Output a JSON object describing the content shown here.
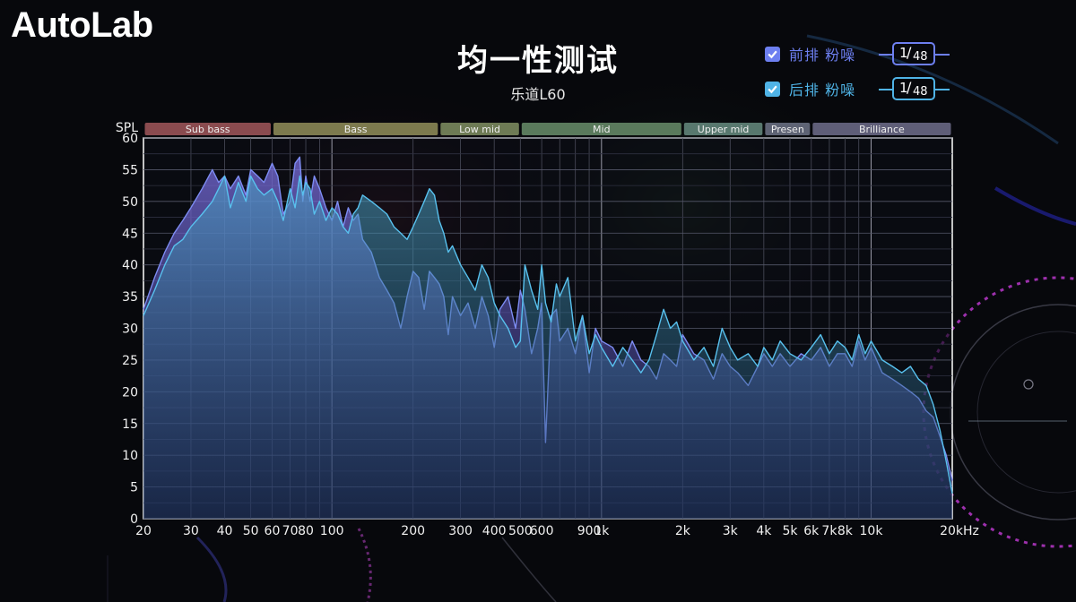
{
  "logo": "AutoLab",
  "title": "均一性测试",
  "subtitle": "乐道L60",
  "legend": [
    {
      "label": "前排 粉噪",
      "checked": true,
      "color": "#6d7ff0",
      "octave_num": "1",
      "octave_den": "48"
    },
    {
      "label": "后排 粉噪",
      "checked": true,
      "color": "#4fb3e6",
      "octave_num": "1",
      "octave_den": "48"
    }
  ],
  "chart_data": {
    "type": "area",
    "x_scale": "log",
    "xlim": [
      20,
      20000
    ],
    "ylim": [
      0,
      60
    ],
    "ylabel": "SPL",
    "y_ticks": [
      0,
      5,
      10,
      15,
      20,
      25,
      30,
      35,
      40,
      45,
      50,
      55,
      60
    ],
    "x_ticks": [
      {
        "v": 20,
        "label": "20"
      },
      {
        "v": 30,
        "label": "30"
      },
      {
        "v": 40,
        "label": "40"
      },
      {
        "v": 50,
        "label": "50"
      },
      {
        "v": 60,
        "label": "60"
      },
      {
        "v": 70,
        "label": "70"
      },
      {
        "v": 80,
        "label": "80"
      },
      {
        "v": 100,
        "label": "100"
      },
      {
        "v": 200,
        "label": "200"
      },
      {
        "v": 300,
        "label": "300"
      },
      {
        "v": 400,
        "label": "400"
      },
      {
        "v": 500,
        "label": "500"
      },
      {
        "v": 600,
        "label": "600"
      },
      {
        "v": 900,
        "label": "900"
      },
      {
        "v": 1000,
        "label": "1k"
      },
      {
        "v": 2000,
        "label": "2k"
      },
      {
        "v": 3000,
        "label": "3k"
      },
      {
        "v": 4000,
        "label": "4k"
      },
      {
        "v": 5000,
        "label": "5k"
      },
      {
        "v": 6000,
        "label": "6k"
      },
      {
        "v": 7000,
        "label": "7k"
      },
      {
        "v": 8000,
        "label": "8k"
      },
      {
        "v": 10000,
        "label": "10k"
      },
      {
        "v": 20000,
        "label": "20kHz"
      }
    ],
    "grid": true,
    "bands": [
      {
        "name": "Sub bass",
        "from": 20,
        "to": 60,
        "color": "#8a4b4f"
      },
      {
        "name": "Bass",
        "from": 60,
        "to": 250,
        "color": "#7d7a4e"
      },
      {
        "name": "Low mid",
        "from": 250,
        "to": 500,
        "color": "#6e7b55"
      },
      {
        "name": "Mid",
        "from": 500,
        "to": 2000,
        "color": "#5a7a5c"
      },
      {
        "name": "Upper mid",
        "from": 2000,
        "to": 4000,
        "color": "#58786e"
      },
      {
        "name": "Presen",
        "from": 4000,
        "to": 6000,
        "color": "#5e6374"
      },
      {
        "name": "Brilliance",
        "from": 6000,
        "to": 20000,
        "color": "#5f5e78"
      }
    ],
    "series": [
      {
        "name": "前排 粉噪",
        "color": "#7d8cf2",
        "x": [
          20,
          22,
          24,
          26,
          28,
          30,
          33,
          36,
          38,
          40,
          42,
          45,
          48,
          50,
          53,
          56,
          60,
          63,
          66,
          70,
          73,
          76,
          78,
          80,
          83,
          86,
          90,
          95,
          100,
          105,
          110,
          115,
          120,
          125,
          130,
          140,
          150,
          160,
          170,
          180,
          190,
          200,
          210,
          220,
          230,
          240,
          250,
          260,
          270,
          280,
          300,
          320,
          340,
          360,
          380,
          400,
          420,
          450,
          480,
          500,
          520,
          550,
          580,
          600,
          620,
          650,
          680,
          700,
          750,
          800,
          850,
          900,
          950,
          1000,
          1100,
          1200,
          1300,
          1400,
          1500,
          1600,
          1700,
          1800,
          1900,
          2000,
          2200,
          2400,
          2600,
          2800,
          3000,
          3200,
          3500,
          3800,
          4000,
          4300,
          4600,
          5000,
          5500,
          6000,
          6500,
          7000,
          7500,
          8000,
          8500,
          9000,
          9500,
          10000,
          11000,
          12000,
          13000,
          14000,
          15000,
          16000,
          17000,
          18000,
          19000,
          20000
        ],
        "values": [
          33,
          38,
          42,
          45,
          47,
          49,
          52,
          55,
          53,
          54,
          52,
          54,
          51,
          55,
          54,
          53,
          56,
          54,
          48,
          50,
          56,
          57,
          50,
          54,
          50,
          54,
          52,
          49,
          47,
          50,
          46,
          49,
          47,
          48,
          44,
          42,
          38,
          36,
          34,
          30,
          35,
          39,
          38,
          33,
          39,
          38,
          37,
          35,
          29,
          35,
          32,
          34,
          30,
          35,
          32,
          27,
          33,
          35,
          30,
          36,
          33,
          26,
          30,
          34,
          12,
          32,
          33,
          28,
          30,
          26,
          32,
          23,
          30,
          28,
          27,
          24,
          28,
          25,
          24,
          22,
          26,
          25,
          24,
          29,
          26,
          25,
          22,
          26,
          24,
          23,
          21,
          24,
          26,
          24,
          26,
          24,
          26,
          25,
          27,
          24,
          26,
          26,
          24,
          28,
          25,
          27,
          23,
          22,
          21,
          20,
          19,
          17,
          16,
          13,
          10,
          6
        ]
      },
      {
        "name": "后排 粉噪",
        "color": "#58c1ee",
        "x": [
          20,
          22,
          24,
          26,
          28,
          30,
          33,
          36,
          38,
          40,
          42,
          45,
          48,
          50,
          53,
          56,
          60,
          63,
          66,
          70,
          73,
          76,
          78,
          80,
          83,
          86,
          90,
          95,
          100,
          105,
          110,
          115,
          120,
          125,
          130,
          140,
          150,
          160,
          170,
          180,
          190,
          200,
          210,
          220,
          230,
          240,
          250,
          260,
          270,
          280,
          300,
          320,
          340,
          360,
          380,
          400,
          420,
          450,
          480,
          500,
          520,
          550,
          580,
          600,
          620,
          650,
          680,
          700,
          750,
          800,
          850,
          900,
          950,
          1000,
          1100,
          1200,
          1300,
          1400,
          1500,
          1600,
          1700,
          1800,
          1900,
          2000,
          2200,
          2400,
          2600,
          2800,
          3000,
          3200,
          3500,
          3800,
          4000,
          4300,
          4600,
          5000,
          5500,
          6000,
          6500,
          7000,
          7500,
          8000,
          8500,
          9000,
          9500,
          10000,
          11000,
          12000,
          13000,
          14000,
          15000,
          16000,
          17000,
          18000,
          19000,
          20000
        ],
        "values": [
          32,
          36,
          40,
          43,
          44,
          46,
          48,
          50,
          52,
          54,
          49,
          53,
          50,
          54,
          52,
          51,
          52,
          50,
          47,
          52,
          49,
          54,
          51,
          53,
          52,
          48,
          50,
          47,
          49,
          48,
          46,
          45,
          48,
          49,
          51,
          50,
          49,
          48,
          46,
          45,
          44,
          46,
          48,
          50,
          52,
          51,
          47,
          45,
          42,
          43,
          40,
          38,
          36,
          40,
          38,
          34,
          32,
          30,
          27,
          28,
          40,
          36,
          33,
          40,
          34,
          31,
          37,
          35,
          38,
          28,
          32,
          26,
          29,
          27,
          24,
          27,
          25,
          23,
          25,
          29,
          33,
          30,
          31,
          28,
          25,
          27,
          24,
          30,
          27,
          25,
          26,
          24,
          27,
          25,
          28,
          26,
          25,
          27,
          29,
          26,
          28,
          27,
          25,
          29,
          26,
          28,
          25,
          24,
          23,
          24,
          22,
          21,
          18,
          14,
          9,
          4
        ]
      }
    ]
  }
}
